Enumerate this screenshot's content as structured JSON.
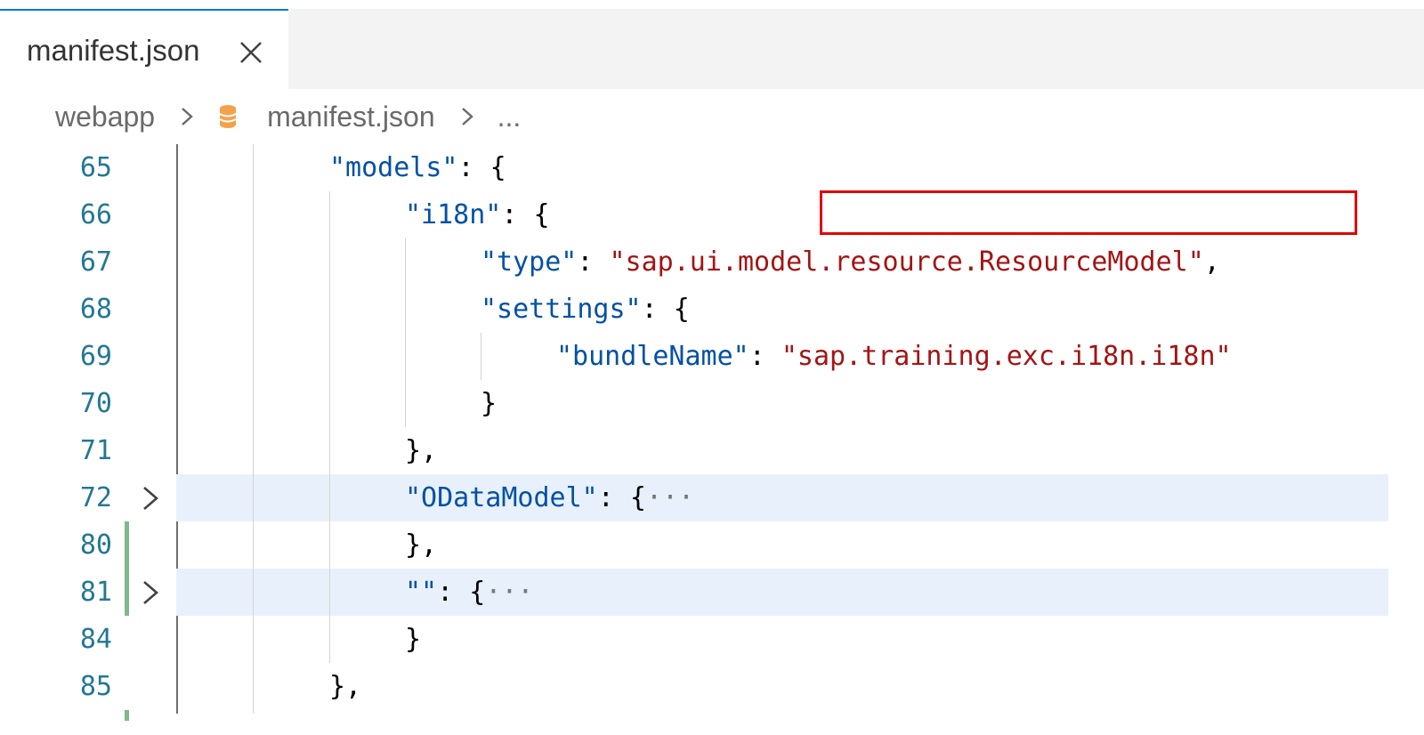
{
  "tab": {
    "label": "manifest.json",
    "close_icon": "close-icon"
  },
  "breadcrumb": {
    "items": [
      "webapp",
      "manifest.json",
      "..."
    ],
    "file_icon": "json-file-icon",
    "separator_icon": "chevron-right-icon"
  },
  "code": {
    "lines": [
      {
        "number": "65",
        "tokens": [
          {
            "t": "\"models\"",
            "c": "k"
          },
          {
            "t": ": {",
            "c": "p"
          }
        ]
      },
      {
        "number": "66",
        "tokens": [
          {
            "t": "\"i18n\"",
            "c": "k"
          },
          {
            "t": ": {",
            "c": "p"
          }
        ]
      },
      {
        "number": "67",
        "tokens": [
          {
            "t": "\"type\"",
            "c": "k"
          },
          {
            "t": ": ",
            "c": "p"
          },
          {
            "t": "\"sap.ui.model.resource.ResourceModel\"",
            "c": "s"
          },
          {
            "t": ",",
            "c": "p"
          }
        ]
      },
      {
        "number": "68",
        "tokens": [
          {
            "t": "\"settings\"",
            "c": "k"
          },
          {
            "t": ": {",
            "c": "p"
          }
        ]
      },
      {
        "number": "69",
        "tokens": [
          {
            "t": "\"bundleName\"",
            "c": "k"
          },
          {
            "t": ": ",
            "c": "p"
          },
          {
            "t": "\"sap.training.exc.i18n.i18n\"",
            "c": "s"
          }
        ]
      },
      {
        "number": "70",
        "tokens": [
          {
            "t": "}",
            "c": "p"
          }
        ]
      },
      {
        "number": "71",
        "tokens": [
          {
            "t": "},",
            "c": "p"
          }
        ]
      },
      {
        "number": "72",
        "tokens": [
          {
            "t": "\"ODataModel\"",
            "c": "k"
          },
          {
            "t": ": {",
            "c": "p"
          },
          {
            "t": "···",
            "c": "dots"
          }
        ]
      },
      {
        "number": "80",
        "tokens": [
          {
            "t": "},",
            "c": "p"
          }
        ]
      },
      {
        "number": "81",
        "tokens": [
          {
            "t": "\"\"",
            "c": "k"
          },
          {
            "t": ": {",
            "c": "p"
          },
          {
            "t": "···",
            "c": "dots"
          }
        ]
      },
      {
        "number": "84",
        "tokens": [
          {
            "t": "}",
            "c": "p"
          }
        ]
      },
      {
        "number": "85",
        "tokens": [
          {
            "t": "},",
            "c": "p"
          }
        ]
      }
    ]
  },
  "colors": {
    "line_number": "#237893",
    "json_key": "#0451a5",
    "json_string": "#a31515",
    "highlight_box": "#e00000",
    "git_modified": "#81b88b",
    "active_tab_border": "#0078d4"
  }
}
